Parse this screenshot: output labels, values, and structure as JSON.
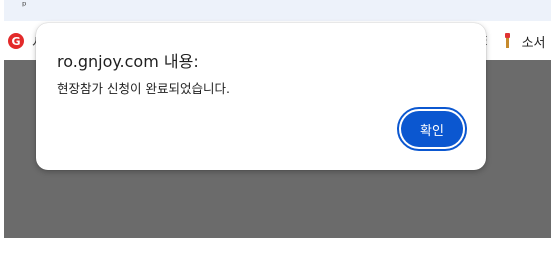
{
  "address_bar": {
    "caret": "ᵖ"
  },
  "bookmarks": {
    "left_label": "서",
    "left_logo_glyph": "G",
    "right_separator": "E",
    "right_label": "소서",
    "right_icon": "bookmark-flag-icon"
  },
  "dialog": {
    "title": "ro.gnjoy.com 내용:",
    "message": "현장참가 신청이 완료되었습니다.",
    "ok_label": "확인"
  },
  "colors": {
    "overlay": "#6b6b6b",
    "accent": "#0b57d0",
    "logo": "#e32a2a"
  }
}
